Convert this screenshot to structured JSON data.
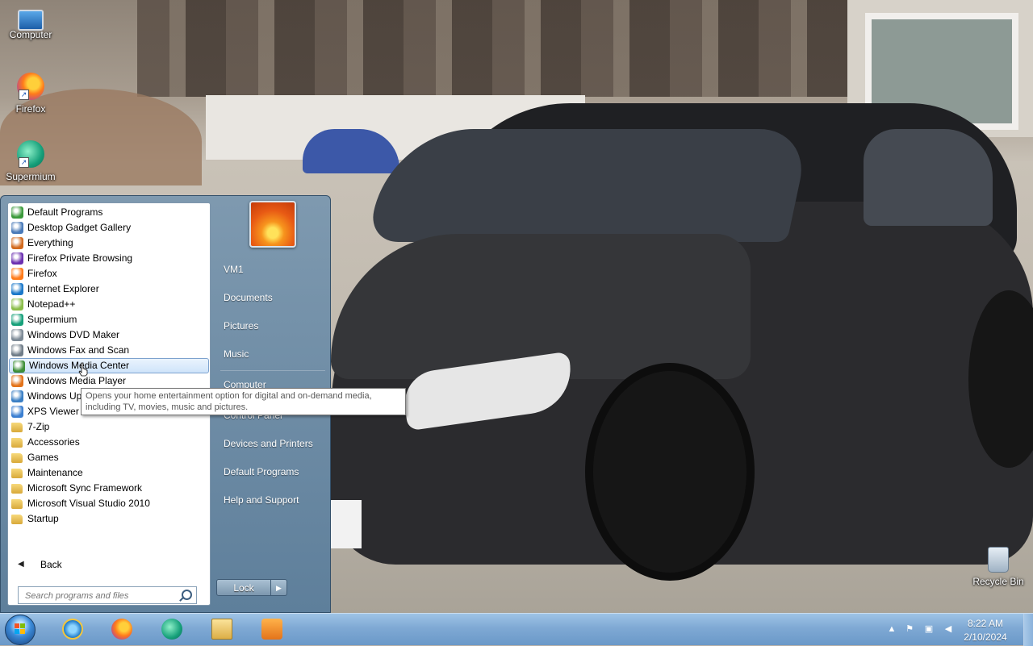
{
  "desktop": {
    "icons": [
      {
        "label": "Computer",
        "icon": "computer-icon"
      },
      {
        "label": "Firefox",
        "icon": "firefox-icon"
      },
      {
        "label": "Supermium",
        "icon": "supermium-icon"
      },
      {
        "label": "Recycle Bin",
        "icon": "recycle-bin-icon"
      }
    ]
  },
  "start_menu": {
    "programs": [
      {
        "label": "Default Programs",
        "icon": "default-programs-icon"
      },
      {
        "label": "Desktop Gadget Gallery",
        "icon": "gadget-gallery-icon"
      },
      {
        "label": "Everything",
        "icon": "everything-search-icon"
      },
      {
        "label": "Firefox Private Browsing",
        "icon": "firefox-private-icon"
      },
      {
        "label": "Firefox",
        "icon": "firefox-icon"
      },
      {
        "label": "Internet Explorer",
        "icon": "internet-explorer-icon"
      },
      {
        "label": "Notepad++",
        "icon": "notepad-plus-plus-icon"
      },
      {
        "label": "Supermium",
        "icon": "supermium-icon"
      },
      {
        "label": "Windows DVD Maker",
        "icon": "dvd-maker-icon"
      },
      {
        "label": "Windows Fax and Scan",
        "icon": "fax-scan-icon"
      },
      {
        "label": "Windows Media Center",
        "icon": "media-center-icon"
      },
      {
        "label": "Windows Media Player",
        "icon": "media-player-icon"
      },
      {
        "label": "Windows Update",
        "icon": "windows-update-icon"
      },
      {
        "label": "XPS Viewer",
        "icon": "xps-viewer-icon"
      },
      {
        "label": "7-Zip",
        "icon": "folder-icon"
      },
      {
        "label": "Accessories",
        "icon": "folder-icon"
      },
      {
        "label": "Games",
        "icon": "folder-icon"
      },
      {
        "label": "Maintenance",
        "icon": "folder-icon"
      },
      {
        "label": "Microsoft Sync Framework",
        "icon": "folder-icon"
      },
      {
        "label": "Microsoft Visual Studio 2010",
        "icon": "folder-icon"
      },
      {
        "label": "Startup",
        "icon": "folder-icon"
      }
    ],
    "highlighted_program": "Windows Media Center",
    "back_label": "Back",
    "search_placeholder": "Search programs and files",
    "right_items": [
      {
        "label": "VM1"
      },
      {
        "label": "Documents"
      },
      {
        "label": "Pictures"
      },
      {
        "label": "Music"
      },
      {
        "label": "Computer"
      },
      {
        "label": "Control Panel"
      },
      {
        "label": "Devices and Printers"
      },
      {
        "label": "Default Programs"
      },
      {
        "label": "Help and Support"
      }
    ],
    "lock_label": "Lock",
    "tooltip": "Opens your home entertainment option for digital and on-demand media, including TV, movies, music and pictures."
  },
  "taskbar": {
    "pinned": [
      "internet-explorer-icon",
      "firefox-icon",
      "supermium-icon",
      "windows-explorer-icon",
      "media-player-icon"
    ],
    "clock_time": "8:22 AM",
    "clock_date": "2/10/2024"
  }
}
